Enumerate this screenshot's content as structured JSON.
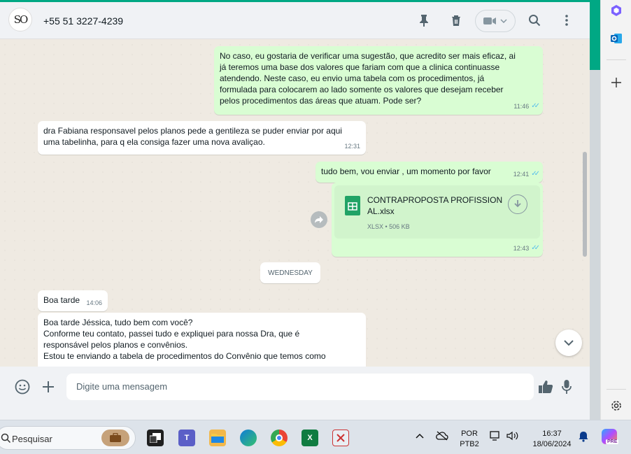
{
  "header": {
    "contact_name": "+55 51 3227-4239",
    "avatar_text": "SO"
  },
  "messages": [
    {
      "direction": "out",
      "lines": [
        "No caso, eu gostaria de verificar uma sugestão, que acredito ser mais eficaz, ai",
        "já teremos uma base dos valores que fariam com que a clinica continuasse",
        "atendendo. Neste caso, eu envio uma tabela com os procedimentos, já",
        "formulada para colocarem ao lado somente os valores que desejam receber",
        "pelos procedimentos das áreas que atuam. Pode ser?"
      ],
      "time": "11:46"
    },
    {
      "direction": "in",
      "lines": [
        "dra Fabiana responsavel pelos planos pede a gentileza se puder enviar por aqui",
        "uma tabelinha, para q ela consiga fazer uma nova avaliçao."
      ],
      "time": "12:31"
    },
    {
      "direction": "out",
      "lines": [
        "tudo bem, vou enviar , um momento por favor"
      ],
      "time": "12:41"
    },
    {
      "direction": "out",
      "type": "file",
      "file_name": "CONTRAPROPOSTA PROFISSIONAL.xlsx",
      "file_meta": "XLSX • 506 KB",
      "time": "12:43"
    },
    {
      "direction": "in",
      "lines": [
        "Boa tarde"
      ],
      "time": "14:06"
    },
    {
      "direction": "in",
      "lines": [
        "Boa tarde Jéssica, tudo bem com você?",
        "Conforme teu contato, passei tudo e expliquei para nossa Dra, que é",
        "responsável pelos planos e convênios.",
        "Estou  te enviando a tabela de procedimentos do Convênio que temos como"
      ],
      "time": ""
    }
  ],
  "day_divider": "WEDNESDAY",
  "composer": {
    "placeholder": "Digite uma mensagem"
  },
  "taskbar": {
    "search_placeholder": "Pesquisar",
    "language": "POR",
    "keyboard": "PTB2",
    "time": "16:37",
    "date": "18/06/2024",
    "copilot_badge": "PRE"
  },
  "colors": {
    "accent": "#00a884",
    "outgoing_bubble": "#d9fdd3",
    "incoming_bubble": "#ffffff",
    "read_ticks": "#53bdeb"
  }
}
